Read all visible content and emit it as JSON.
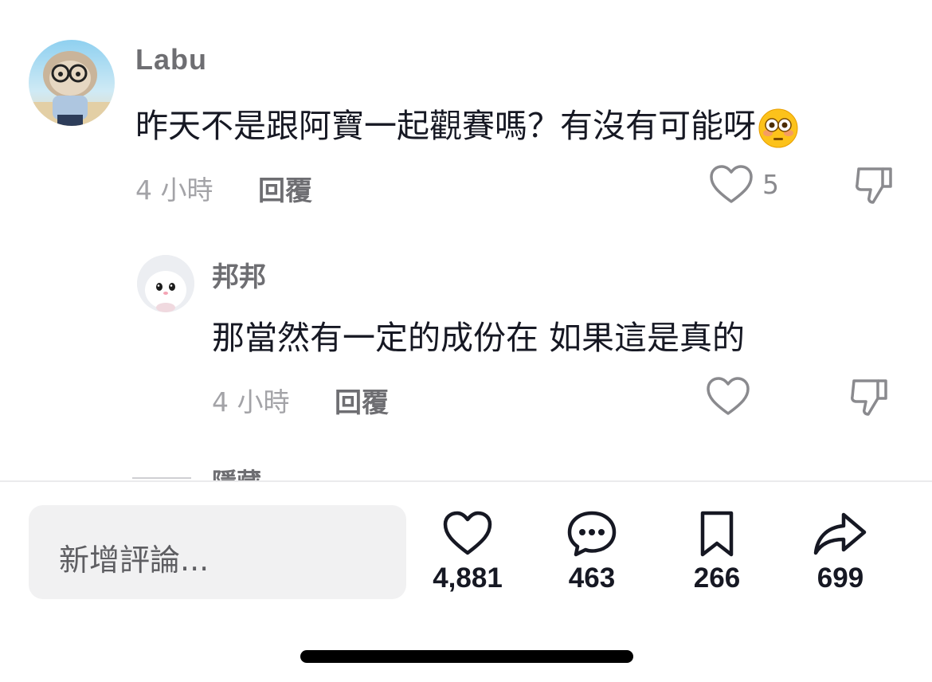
{
  "comments": [
    {
      "username": "Labu",
      "text": "昨天不是跟阿寶一起觀賽嗎？有沒有可能呀",
      "emoji": "flushed-face-emoji",
      "time": "4 小時",
      "reply_label": "回覆",
      "like_count": "5"
    },
    {
      "username": "邦邦",
      "text": "那當然有一定的成份在 如果這是真的",
      "time": "4 小時",
      "reply_label": "回覆"
    }
  ],
  "collapse_label": "隱藏",
  "bottom_bar": {
    "input_placeholder": "新增評論...",
    "likes": "4,881",
    "comments": "463",
    "saves": "266",
    "shares": "699"
  },
  "colors": {
    "text_primary": "#161823",
    "text_secondary": "#6e6e72",
    "input_bg": "#f1f1f2"
  }
}
